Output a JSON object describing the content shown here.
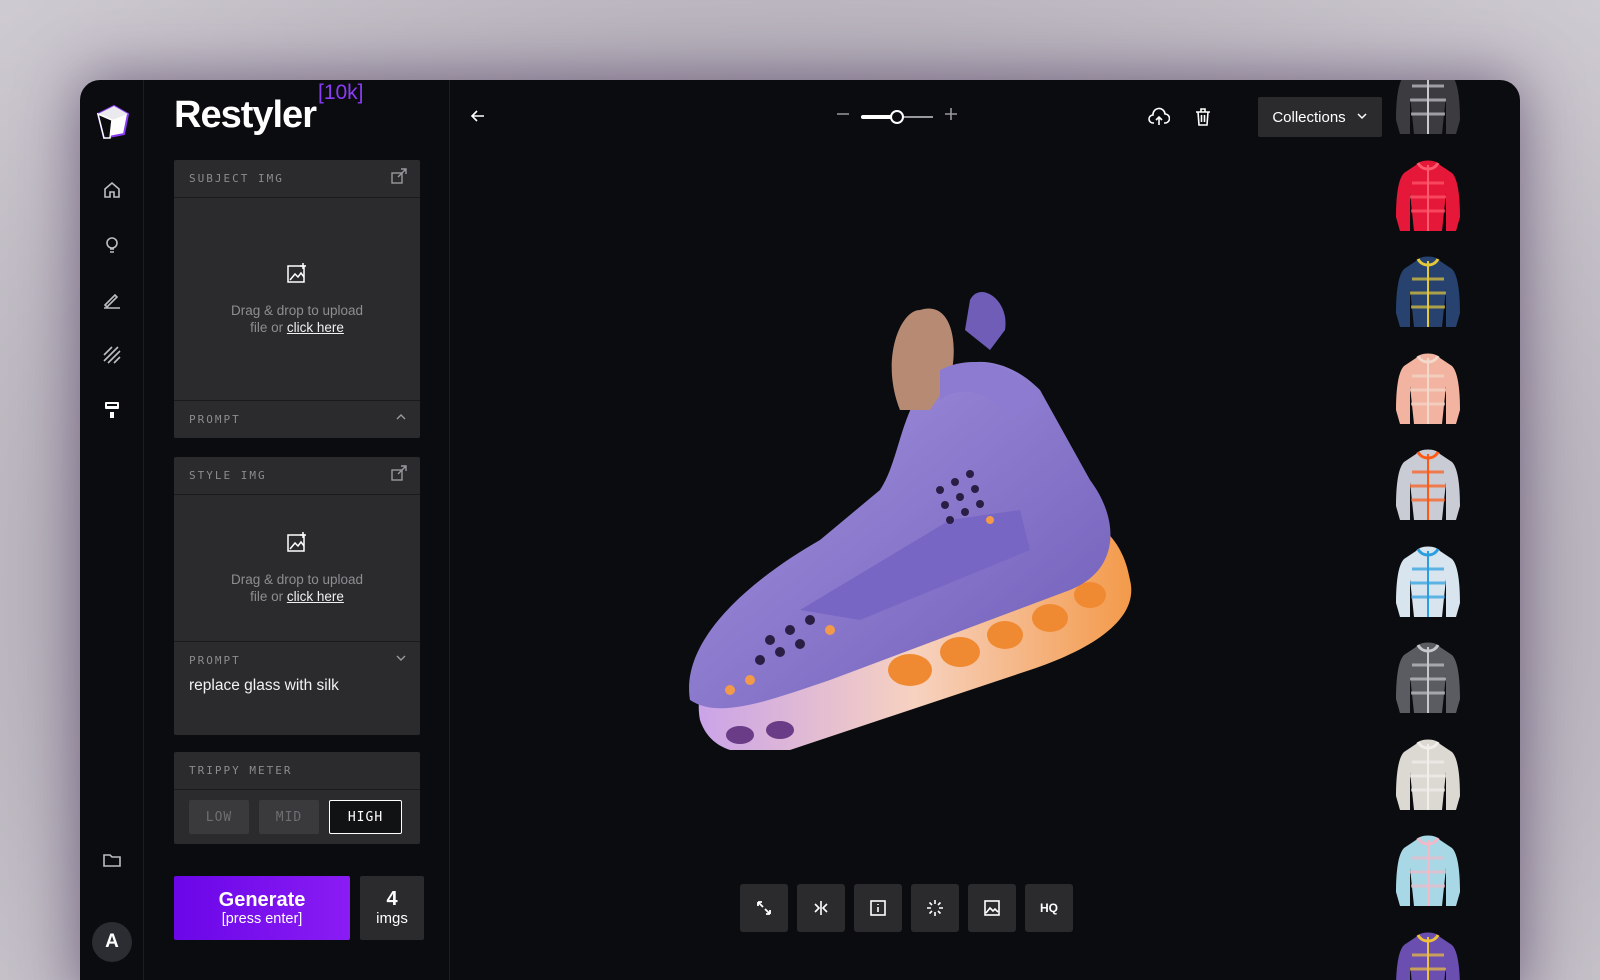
{
  "brand": {
    "name": "Restyler",
    "badge": "[10k]"
  },
  "rail": {
    "items": [
      {
        "icon": "home-icon"
      },
      {
        "icon": "lightbulb-icon"
      },
      {
        "icon": "pen-icon"
      },
      {
        "icon": "hatch-icon"
      },
      {
        "icon": "paint-roller-icon"
      }
    ],
    "avatar_initial": "A"
  },
  "subject": {
    "label": "SUBJECT IMG",
    "drop_line1": "Drag & drop to upload",
    "drop_line2": "file or",
    "drop_link": "click here",
    "prompt_label": "PROMPT"
  },
  "style": {
    "label": "STYLE IMG",
    "drop_line1": "Drag & drop to upload",
    "drop_line2": "file or",
    "drop_link": "click here",
    "prompt_label": "PROMPT",
    "prompt_value": "replace glass with silk"
  },
  "trippy": {
    "label": "TRIPPY METER",
    "options": [
      "LOW",
      "MID",
      "HIGH"
    ],
    "selected": "HIGH"
  },
  "generate": {
    "title": "Generate",
    "hint": "[press enter]"
  },
  "image_count": {
    "value": "4",
    "label": "imgs"
  },
  "topbar": {
    "collections_label": "Collections",
    "zoom_level": 0.5
  },
  "toolbar": {
    "hq_label": "HQ"
  },
  "colors": {
    "accent": "#8a3cf4",
    "generate_start": "#6a06e8",
    "panel_card": "#2b2b2d",
    "background": "#0b0c0f",
    "shoe_body": "#8f7fd0",
    "shoe_sole": "#f3a25a"
  },
  "gallery": {
    "thumbs": [
      {
        "icon": "jacket-thumbnail",
        "color": "#3b3b40",
        "accent": "#c9c9cf"
      },
      {
        "icon": "jacket-thumbnail",
        "color": "#e5183a",
        "accent": "#ff5a6e"
      },
      {
        "icon": "jacket-thumbnail",
        "color": "#27426e",
        "accent": "#e5c83a"
      },
      {
        "icon": "jacket-thumbnail",
        "color": "#f2b3a0",
        "accent": "#f3d8cc"
      },
      {
        "icon": "jacket-thumbnail",
        "color": "#c9ccd4",
        "accent": "#ff5a14"
      },
      {
        "icon": "jacket-thumbnail",
        "color": "#d8e4ee",
        "accent": "#2a9ee0"
      },
      {
        "icon": "jacket-thumbnail",
        "color": "#5a5c62",
        "accent": "#c7c8cc"
      },
      {
        "icon": "jacket-thumbnail",
        "color": "#dcd8d2",
        "accent": "#f1efec"
      },
      {
        "icon": "jacket-thumbnail",
        "color": "#a8d8e6",
        "accent": "#f2b9c8"
      },
      {
        "icon": "jacket-thumbnail",
        "color": "#6a4fb0",
        "accent": "#f0c23a"
      }
    ]
  }
}
